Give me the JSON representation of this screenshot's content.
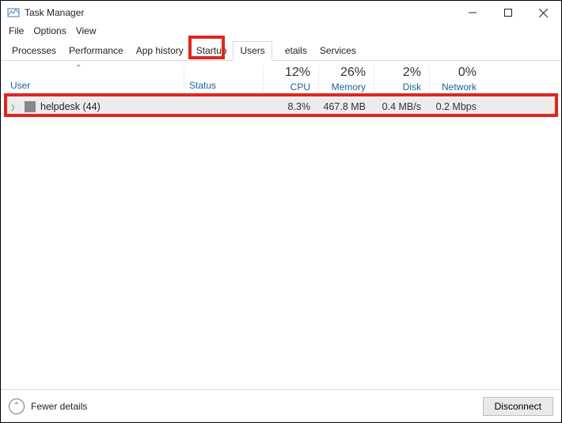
{
  "window": {
    "title": "Task Manager"
  },
  "menu": {
    "file": "File",
    "options": "Options",
    "view": "View"
  },
  "tabs": {
    "processes": "Processes",
    "performance": "Performance",
    "app_history": "App history",
    "startup": "Startup",
    "users": "Users",
    "details_partial": "etails",
    "services": "Services"
  },
  "columns": {
    "user": "User",
    "status": "Status",
    "cpu": {
      "pct": "12%",
      "label": "CPU"
    },
    "memory": {
      "pct": "26%",
      "label": "Memory"
    },
    "disk": {
      "pct": "2%",
      "label": "Disk"
    },
    "network": {
      "pct": "0%",
      "label": "Network"
    }
  },
  "rows": [
    {
      "user": "helpdesk (44)",
      "status": "",
      "cpu": "8.3%",
      "memory": "467.8 MB",
      "disk": "0.4 MB/s",
      "network": "0.2 Mbps"
    }
  ],
  "footer": {
    "fewer": "Fewer details",
    "disconnect": "Disconnect"
  }
}
